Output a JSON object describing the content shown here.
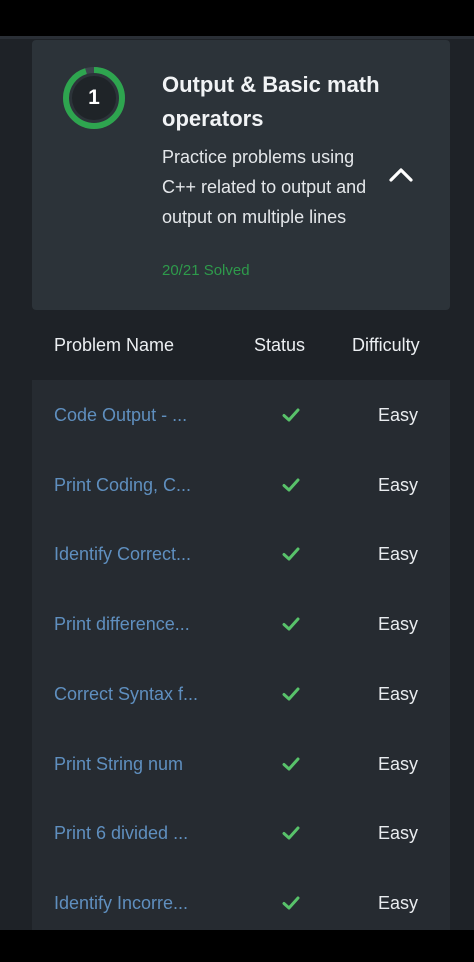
{
  "module": {
    "number": "1",
    "title": "Output & Basic math operators",
    "description": "Practice problems using C++ related to output and output on multiple lines",
    "solved_text": "20/21 Solved",
    "progress_fraction": 0.952,
    "progress_color": "#2ea54f",
    "collapse_icon": "chevron-up-icon"
  },
  "table": {
    "headers": {
      "name": "Problem Name",
      "status": "Status",
      "difficulty": "Difficulty"
    },
    "rows": [
      {
        "name": "Code Output - ...",
        "status": "solved",
        "difficulty": "Easy"
      },
      {
        "name": "Print Coding, C...",
        "status": "solved",
        "difficulty": "Easy"
      },
      {
        "name": "Identify Correct...",
        "status": "solved",
        "difficulty": "Easy"
      },
      {
        "name": "Print difference...",
        "status": "solved",
        "difficulty": "Easy"
      },
      {
        "name": "Correct Syntax f...",
        "status": "solved",
        "difficulty": "Easy"
      },
      {
        "name": "Print String num",
        "status": "solved",
        "difficulty": "Easy"
      },
      {
        "name": "Print 6 divided ...",
        "status": "solved",
        "difficulty": "Easy"
      },
      {
        "name": "Identify Incorre...",
        "status": "solved",
        "difficulty": "Easy"
      }
    ]
  },
  "colors": {
    "link": "#5f8fbf",
    "check": "#58c26a",
    "card_bg": "#2c3339",
    "page_bg": "#1e2227"
  }
}
